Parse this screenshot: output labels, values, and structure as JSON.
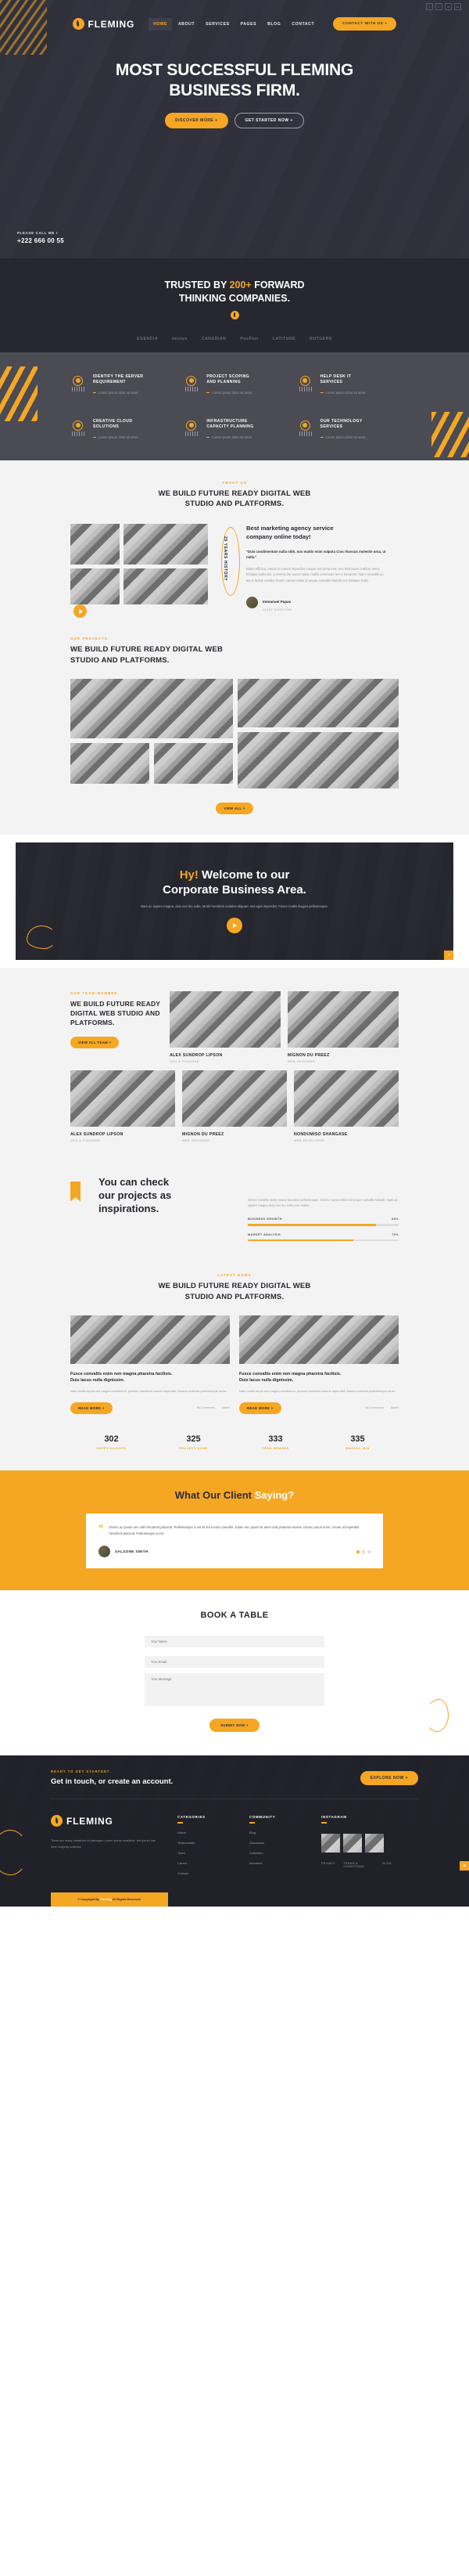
{
  "header": {
    "brand": "FLEMING",
    "nav": [
      {
        "label": "HOME",
        "active": true
      },
      {
        "label": "ABOUT",
        "active": false
      },
      {
        "label": "SERVICES",
        "active": false
      },
      {
        "label": "PAGES",
        "active": false
      },
      {
        "label": "BLOG",
        "active": false
      },
      {
        "label": "CONTACT",
        "active": false
      }
    ],
    "cta": "CONTACT WITH US  +",
    "social": [
      "f",
      "t",
      "in",
      "be"
    ]
  },
  "hero": {
    "title_line1": "MOST SUCCESSFUL FLEMING",
    "title_line2": "BUSINESS FIRM.",
    "btn_primary": "DISCOVER MORE  +",
    "btn_secondary": "GET STARTED NOW  +",
    "phone_label": "PLEASE CALL ME !",
    "phone_number": "+222 666 00 55"
  },
  "trusted": {
    "line1_a": "TRUSTED BY ",
    "line1_highlight": "200+",
    "line1_b": " FORWARD",
    "line2": "THINKING COMPANIES.",
    "logos": [
      "EGENCIA",
      "nexion",
      "CANADIAN",
      "PosFluv",
      "LATITUDE",
      "RUTGERS"
    ]
  },
  "services": {
    "items": [
      {
        "title_line1": "IDENTIFY THE SERVER",
        "title_line2": "REQUIREMENT",
        "desc": "Lorem ipsum dolor sit amet."
      },
      {
        "title_line1": "PROJECT SCOPING",
        "title_line2": "AND PLANNING",
        "desc": "Lorem ipsum dolor sit amet."
      },
      {
        "title_line1": "HELP DESK IT",
        "title_line2": "SERVICES",
        "desc": "Lorem ipsum dolor sit amet."
      },
      {
        "title_line1": "CREATIVE CLOUD",
        "title_line2": "SOLUTIONS",
        "desc": "Lorem ipsum dolor sit amet."
      },
      {
        "title_line1": "INFRASTRUCTURE",
        "title_line2": "CAPACITY PLANNING",
        "desc": "Lorem ipsum dolor sit amet."
      },
      {
        "title_line1": "OUR TECHNOLOGY",
        "title_line2": "SERVICES",
        "desc": "Lorem ipsum dolor sit amet."
      }
    ]
  },
  "about": {
    "eyebrow": "ABOUT US",
    "title_line1": "WE BUILD FUTURE READY DIGITAL WEB",
    "title_line2": "STUDIO AND PLATFORMS.",
    "badge": "25 YEARS HISTORY",
    "heading_line1": "Best marketing agency service",
    "heading_line2": "company online today!",
    "quote": "\"Duis condimentum nulla nibh, non mattis enim vulputa Cras rhoncus molestie urna, ut nulla.\"",
    "paragraph": "Etiam efficitur, metus in cursus imperdiet, neque nisl porta erat, nec felis lacus a tellus. Nunc tristique nulla nisi, a viverra dui auctor vitae, mollis commodo leo in hendrerit. Nam convallis ac lacus luctus vestibu Donec cursus tellus id neque convallis blandit uoc tristique nulla."
  },
  "about_author": {
    "name": "Immanuel Papas",
    "role": "CHIEF DIRECTOR"
  },
  "portfolio": {
    "eyebrow": "OUR PROJECTS",
    "title_line1": "WE BUILD FUTURE READY DIGITAL WEB",
    "title_line2": "STUDIO AND PLATFORMS.",
    "button": "VIEW ALL  +"
  },
  "welcome": {
    "hi": "Hy!",
    "line1_rest": " Welcome to our",
    "line2": "Corporate Business Area.",
    "paragraph": "Nam ac sapien magna, duis nec leo nulla. Morbi hendrerit sodales aliquam sed eget imperdiet. Fusce mattis feugiat pellentesque."
  },
  "team": {
    "eyebrow": "OUR TEAM MEMBER",
    "title_line1": "WE BUILD FUTURE READY",
    "title_line2": "DIGITAL WEB STUDIO AND",
    "title_line3": "PLATFORMS.",
    "button": "VIEW ALL TEAM  +",
    "row1": [
      {
        "name": "ALEX SUNDROP LIPSON",
        "role": "CEO & FOUNDER"
      },
      {
        "name": "MIGNON DU PREEZ",
        "role": "WEB DESIGNER"
      }
    ],
    "row2": [
      {
        "name": "ALEX SUNDROP LIPSON",
        "role": "CEO & FOUNDER"
      },
      {
        "name": "MIGNON DU PREEZ",
        "role": "WEB DESIGNER"
      },
      {
        "name": "NONDUMISO SHANGASE",
        "role": "WEB DEVELOPER"
      }
    ]
  },
  "projects": {
    "title_line1": "You can check",
    "title_line2": "our projects as",
    "title_line3": "inspirations.",
    "paragraph": "Donec sodales dolor neque faucibus pellentesque. Donec cursus tellus id neque convallis blandit. Nam ac sapien magna duis nec leo nulla non mattis.",
    "bars": [
      {
        "label": "BUSINESS GROWTH",
        "value": 85,
        "value_label": "85%"
      },
      {
        "label": "MARKET ANALYSIS",
        "value": 70,
        "value_label": "70%"
      }
    ]
  },
  "blog": {
    "eyebrow": "LATEST NEWS",
    "title_line1": "WE BUILD FUTURE READY DIGITAL WEB",
    "title_line2": "STUDIO AND PLATFORMS.",
    "cards": [
      {
        "title_line1": "Fusce convallis enim non magna pharetra facilisis.",
        "title_line2": "Duis lacus nulla dignissim.",
        "excerpt": "Nam mollis turpis sed magna vestibulum, pretium maximus mauris imperdiet. Mauris vehicula pellentesque tortor.",
        "button": "READ MORE  +",
        "comments": "No Comments",
        "date": "Admin"
      },
      {
        "title_line1": "Fusce convallis enim non magna pharetra facilisis.",
        "title_line2": "Duis lacus nulla dignissim.",
        "excerpt": "Nam mollis turpis sed magna vestibulum, pretium maximus mauris imperdiet. Mauris vehicula pellentesque tortor.",
        "button": "READ MORE  +",
        "comments": "No Comments",
        "date": "Admin"
      }
    ]
  },
  "counters": [
    {
      "number": "302",
      "label": "HAPPY CLIENTS"
    },
    {
      "number": "325",
      "label": "PROJECT DONE"
    },
    {
      "number": "333",
      "label": "TEAM MEMBER"
    },
    {
      "number": "335",
      "label": "AWARDS WIN"
    }
  ],
  "testimonial": {
    "title_a": "What Our Client ",
    "title_b": "Saying?",
    "quote_mark": "“",
    "quote": "Donec ac ipsum nec nibh hendrerit placerat. Pellentesque a est sit leo luctus convallis. Etiam nec quam sit amet odio pharetra lacinia. Donec purus enim, ornare ut imperdiet hendrerit placerat. Pellentesque a est.",
    "author": "SALZONE SMITH"
  },
  "booking": {
    "title": "BOOK A TABLE",
    "fields": [
      {
        "placeholder": "Your Name",
        "value": ""
      },
      {
        "placeholder": "Your Email",
        "value": ""
      },
      {
        "placeholder": "Your Message",
        "value": ""
      }
    ],
    "submit": "SUBMIT NOW  +"
  },
  "footer": {
    "cta_eyebrow": "READY TO GET STARTED?",
    "cta_title": "Get in touch, or create an account.",
    "cta_button": "EXPLORE NOW  +",
    "brand": "FLEMING",
    "about": "There are many variations of passages Lorem Ipsum available, the Ipsum has been majority suffered.",
    "col1_title": "CATEGORIES",
    "col1_links": [
      "Home",
      "Testimonials",
      "Team",
      "Career",
      "Contact"
    ],
    "col2_title": "COMMUNITY",
    "col2_links": [
      "Blog",
      "Discussion",
      "Collection",
      "Members"
    ],
    "col3_title": "INSTAGRAM",
    "bottom_links": [
      "PRIVACY",
      "TERMS & CONDITIONS",
      "BLOG"
    ],
    "copyright_a": "© Copyright By ",
    "copyright_brand": "Fleming",
    "copyright_b": " All Rights Reserved."
  },
  "colors": {
    "accent": "#f5a623",
    "dark": "#2f303a",
    "darker": "#26272f",
    "gray": "#4a4b53"
  }
}
